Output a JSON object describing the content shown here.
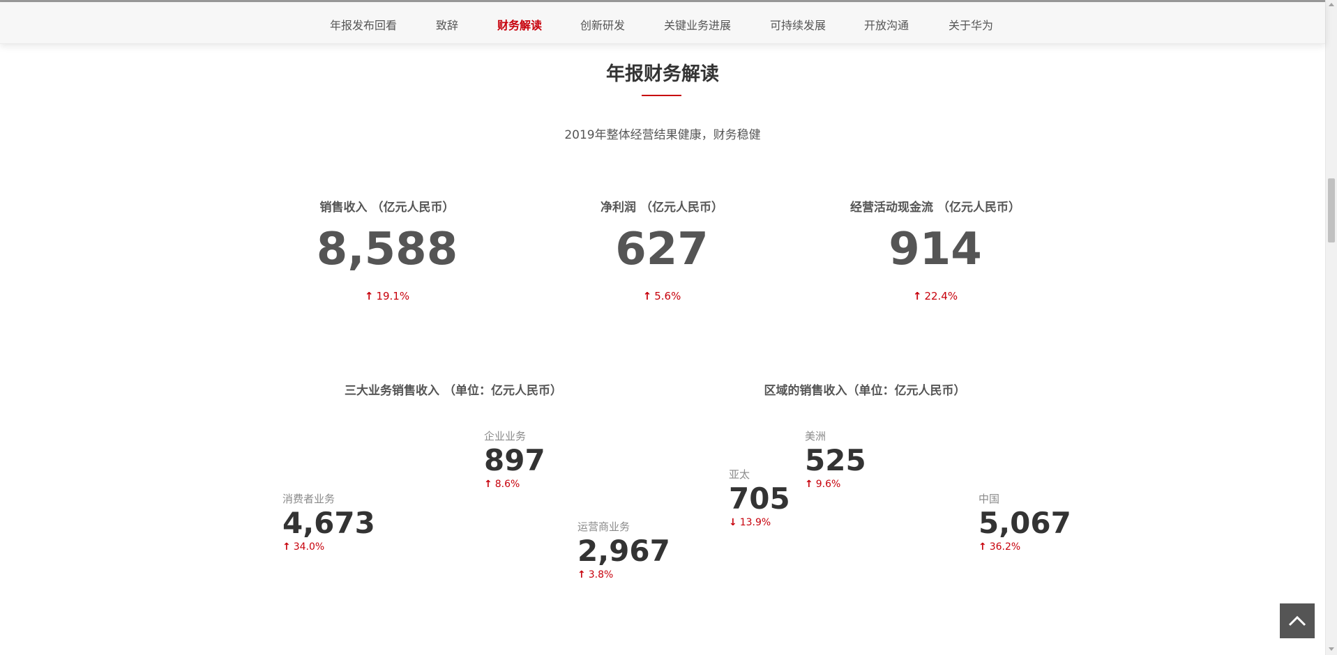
{
  "nav": {
    "items": [
      {
        "label": "年报发布回看"
      },
      {
        "label": "致辞"
      },
      {
        "label": "财务解读",
        "active": true
      },
      {
        "label": "创新研发"
      },
      {
        "label": "关键业务进展"
      },
      {
        "label": "可持续发展"
      },
      {
        "label": "开放沟通"
      },
      {
        "label": "关于华为"
      }
    ]
  },
  "header": {
    "title": "年报财务解读",
    "subtitle": "2019年整体经营结果健康，财务稳健"
  },
  "kpis": [
    {
      "label": "销售收入 （亿元人民币）",
      "value": "8,588",
      "change": "19.1%",
      "direction": "up"
    },
    {
      "label": "净利润 （亿元人民币）",
      "value": "627",
      "change": "5.6%",
      "direction": "up"
    },
    {
      "label": "经营活动现金流 （亿元人民币）",
      "value": "914",
      "change": "22.4%",
      "direction": "up"
    }
  ],
  "business": {
    "title": "三大业务销售收入 （单位：亿元人民币）",
    "items": [
      {
        "label": "企业业务",
        "value": "897",
        "change": "8.6%",
        "direction": "up"
      },
      {
        "label": "消费者业务",
        "value": "4,673",
        "change": "34.0%",
        "direction": "up"
      },
      {
        "label": "运营商业务",
        "value": "2,967",
        "change": "3.8%",
        "direction": "up"
      }
    ]
  },
  "regions": {
    "title": "区域的销售收入（单位：亿元人民币）",
    "items": [
      {
        "label": "美洲",
        "value": "525",
        "change": "9.6%",
        "direction": "up"
      },
      {
        "label": "亚太",
        "value": "705",
        "change": "13.9%",
        "direction": "down"
      },
      {
        "label": "中国",
        "value": "5,067",
        "change": "36.2%",
        "direction": "up"
      }
    ]
  },
  "colors": {
    "accent": "#c7000b",
    "text": "#333333",
    "muted": "#8a8a8a"
  },
  "icons": {
    "up": "arrow-up-icon",
    "down": "arrow-down-icon",
    "back_to_top": "chevron-up-icon"
  }
}
